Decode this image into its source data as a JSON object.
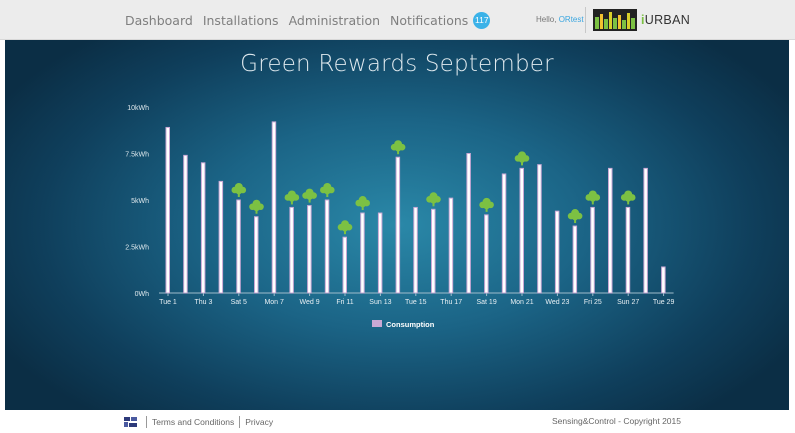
{
  "nav": {
    "items": [
      "Dashboard",
      "Installations",
      "Administration",
      "Notifications"
    ],
    "notification_count": "117",
    "hello_label": "Hello, ",
    "user": "ORtest",
    "brand": "URBAN"
  },
  "main": {
    "title": "Green Rewards September"
  },
  "footer": {
    "terms": "Terms and Conditions",
    "privacy": "Privacy",
    "copyright": "Sensing&Control - Copyright 2015"
  },
  "colors": {
    "bar": "#c9a8d4",
    "bar_fill": "#ffffff",
    "tree": "#7cc143",
    "badge": "#3bb2e8"
  },
  "chart_data": {
    "type": "bar",
    "y_tick_labels": [
      "0Wh",
      "2.5kWh",
      "5kWh",
      "7.5kWh",
      "10kWh"
    ],
    "ylim": [
      0,
      10
    ],
    "unit": "kWh",
    "x_tick_labels": [
      "Tue 1",
      "Thu 3",
      "Sat 5",
      "Mon 7",
      "Wed 9",
      "Fri 11",
      "Sun 13",
      "Tue 15",
      "Thu 17",
      "Sat 19",
      "Mon 21",
      "Wed 23",
      "Fri 25",
      "Sun 27",
      "Tue 29"
    ],
    "categories": [
      "1",
      "2",
      "3",
      "4",
      "5",
      "6",
      "7",
      "8",
      "9",
      "10",
      "11",
      "12",
      "13",
      "14",
      "15",
      "16",
      "17",
      "18",
      "19",
      "20",
      "21",
      "22",
      "23",
      "24",
      "25",
      "26",
      "27",
      "28",
      "29"
    ],
    "series": [
      {
        "name": "Consumption",
        "values": [
          8.9,
          7.4,
          7.0,
          6.0,
          5.0,
          4.1,
          9.2,
          4.6,
          4.7,
          5.0,
          3.0,
          4.3,
          4.3,
          7.3,
          4.6,
          4.5,
          5.1,
          7.5,
          4.2,
          6.4,
          6.7,
          6.9,
          4.4,
          3.6,
          4.6,
          6.7,
          4.6,
          6.7,
          1.4
        ]
      }
    ],
    "green_reward_days": [
      5,
      6,
      8,
      9,
      10,
      11,
      12,
      14,
      16,
      19,
      21,
      24,
      25,
      27
    ],
    "legend": [
      "Consumption"
    ],
    "legend_position": "bottom-center"
  }
}
